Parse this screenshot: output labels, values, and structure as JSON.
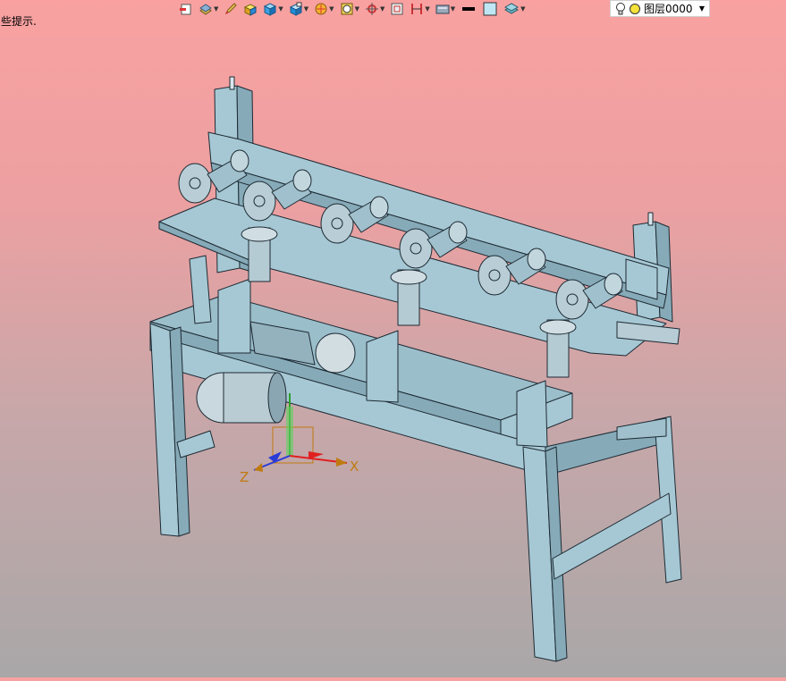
{
  "hint_text": "些提示.",
  "layer": {
    "name": "图层0000"
  },
  "axes": {
    "x_label": "X",
    "z_label": "Z"
  },
  "colors": {
    "background_top": "#f9a1a1",
    "background_bottom": "#a9a7a8",
    "model": "#a6c8d4",
    "model_dark": "#7e9eab",
    "axis_x": "#e02020",
    "axis_z": "#2a3bd8",
    "axis_y": "#2ca02c"
  },
  "toolbar": {
    "items": [
      {
        "icon": "open-part-icon"
      },
      {
        "icon": "layer-settings-icon",
        "dropdown": true
      },
      {
        "icon": "pen-edit-icon"
      },
      {
        "icon": "solid-block-icon"
      },
      {
        "icon": "shaded-view-icon",
        "dropdown": true
      },
      {
        "icon": "view-orient-icon",
        "dropdown": true
      },
      {
        "icon": "section-color-icon",
        "dropdown": true
      },
      {
        "icon": "selection-filter-icon",
        "dropdown": true
      },
      {
        "icon": "snap-point-icon",
        "dropdown": true
      },
      {
        "icon": "frame-icon"
      },
      {
        "icon": "dimension-icon",
        "dropdown": true
      },
      {
        "icon": "display-mode-icon",
        "dropdown": true
      },
      {
        "icon": "line-color-icon"
      },
      {
        "icon": "fill-color-icon"
      },
      {
        "icon": "layer-stack-icon",
        "dropdown": true
      }
    ]
  }
}
